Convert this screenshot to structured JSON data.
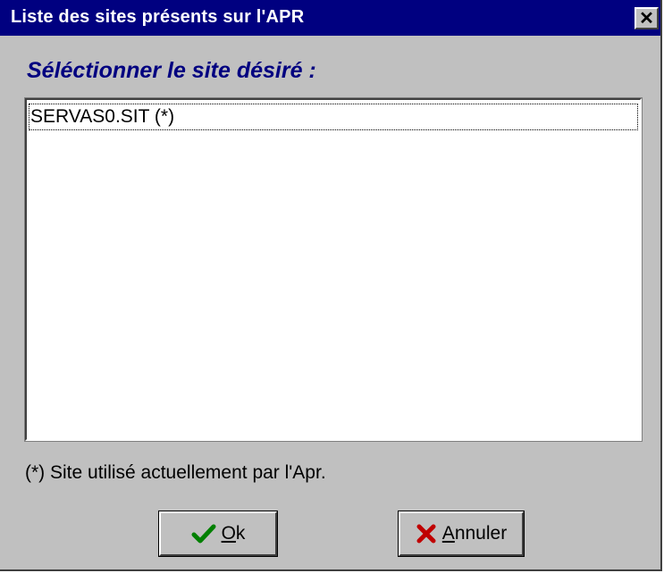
{
  "window": {
    "title": "Liste des sites présents sur l'APR",
    "close_glyph": "✕"
  },
  "prompt": "Séléctionner le site désiré :",
  "sites": [
    {
      "label": "SERVAS0.SIT  (*)",
      "selected": true
    }
  ],
  "footnote": "(*) Site utilisé actuellement par l'Apr.",
  "buttons": {
    "ok": {
      "mnemonic": "O",
      "rest": "k",
      "icon": "check-icon",
      "icon_color": "#008000"
    },
    "cancel": {
      "mnemonic": "A",
      "rest": "nnuler",
      "icon": "x-icon",
      "icon_color": "#c00000"
    }
  }
}
